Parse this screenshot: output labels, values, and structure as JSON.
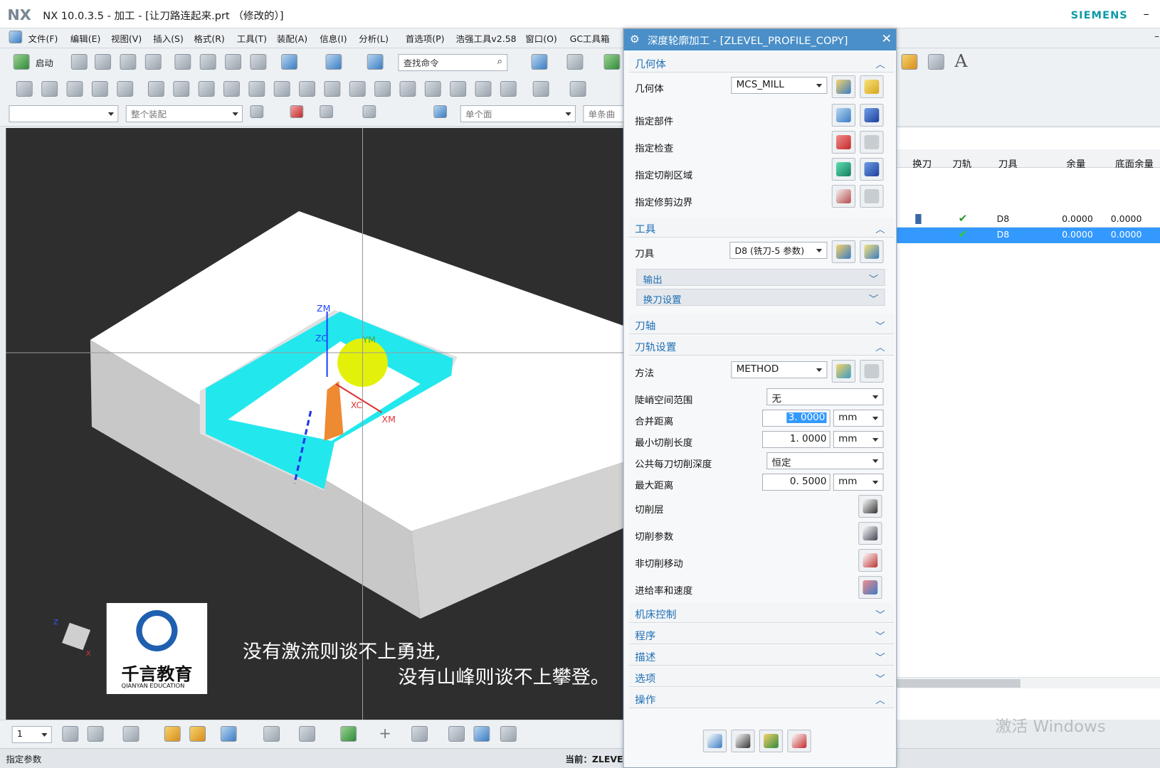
{
  "window": {
    "logo": "NX",
    "title": "NX 10.0.3.5 - 加工 - [让刀路连起来.prt （修改的）]",
    "brand": "SIEMENS"
  },
  "menu": [
    "文件(F)",
    "编辑(E)",
    "视图(V)",
    "插入(S)",
    "格式(R)",
    "工具(T)",
    "装配(A)",
    "信息(I)",
    "分析(L)",
    "首选项(P)",
    "浩强工具v2.58",
    "窗口(O)",
    "GC工具箱"
  ],
  "toolbar": {
    "start_label": "启动",
    "search_placeholder": "查找命令"
  },
  "selection_bar": {
    "filter2": "整个装配",
    "filter3": "单个面",
    "filter4": "单条曲线"
  },
  "viewport": {
    "triad_labels": [
      "ZM",
      "ZC",
      "YM",
      "XC",
      "XM"
    ],
    "mini_axis": [
      "Z",
      "X"
    ],
    "subtitle1": "没有激流则谈不上勇进,",
    "subtitle2": "没有山峰则谈不上攀登。",
    "logo_text": "千言教育",
    "logo_sub": "QIANYAN EDUCATION"
  },
  "bottom_toolbar": {
    "layer_value": "1"
  },
  "statusbar": {
    "left": "指定参数",
    "right": "当前：ZLEVEL"
  },
  "dialog": {
    "title": "深度轮廓加工 - [ZLEVEL_PROFILE_COPY]",
    "geometry": {
      "header": "几何体",
      "geometry_label": "几何体",
      "geometry_value": "MCS_MILL",
      "part": "指定部件",
      "check": "指定检查",
      "cut_area": "指定切削区域",
      "trim": "指定修剪边界"
    },
    "tool": {
      "header": "工具",
      "tool_label": "刀具",
      "tool_value": "D8 (铣刀-5 参数)",
      "output": "输出",
      "tool_change": "换刀设置"
    },
    "axis": {
      "header": "刀轴"
    },
    "path": {
      "header": "刀轨设置",
      "method_label": "方法",
      "method_value": "METHOD",
      "steep_label": "陡峭空间范围",
      "steep_value": "无",
      "merge_label": "合并距离",
      "merge_value": "3. 0000",
      "min_cut_label": "最小切削长度",
      "min_cut_value": "1. 0000",
      "depth_label": "公共每刀切削深度",
      "depth_value": "恒定",
      "max_dist_label": "最大距离",
      "max_dist_value": "0. 5000",
      "unit": "mm",
      "levels": "切削层",
      "params": "切削参数",
      "non_cut": "非切削移动",
      "feeds": "进给率和速度"
    },
    "machine": "机床控制",
    "program": "程序",
    "description": "描述",
    "options": "选项",
    "actions": "操作"
  },
  "navigator": {
    "columns": [
      "换刀",
      "刀轨",
      "刀具",
      "余量",
      "底面余量"
    ],
    "rows": [
      {
        "tool": "D8",
        "stock": "0.0000",
        "floor": "0.0000",
        "selected": false
      },
      {
        "tool": "D8",
        "stock": "0.0000",
        "floor": "0.0000",
        "selected": true
      }
    ]
  },
  "watermark": "激活 Windows",
  "colors": {
    "accent": "#3399ff",
    "title_blue": "#1f6fb4",
    "viewport_bg": "#2e2e2e",
    "dialog_title_bg": "#4a8fc8"
  }
}
